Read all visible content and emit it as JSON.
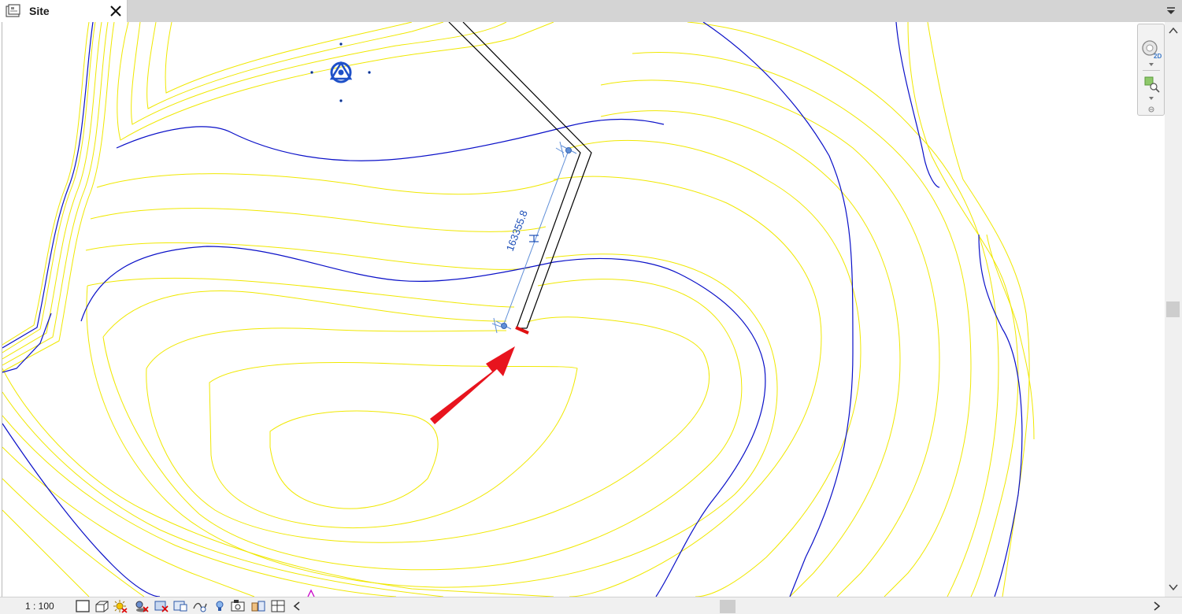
{
  "tab": {
    "title": "Site",
    "icon": "site-view-icon"
  },
  "drawing": {
    "dimension_label": "163355.8",
    "colors": {
      "minor_contour": "#f0e800",
      "major_contour": "#0a10c8",
      "dimension": "#5f8fd8",
      "boundary": "#000000",
      "highlight": "#e01010",
      "annotation_arrow": "#e8141e",
      "survey_point": "#1e50c8"
    }
  },
  "navigation_bar": {
    "icons": [
      "steering-wheel-2d-icon",
      "zoom-region-icon"
    ]
  },
  "status_bar": {
    "scale": "1 : 100",
    "icons": [
      "detail-level-icon",
      "visual-style-icon",
      "sun-path-icon",
      "shadows-icon",
      "crop-view-icon",
      "show-crop-region-icon",
      "unlock-3d-view-icon",
      "temporary-hide-icon",
      "reveal-hidden-icon",
      "temporary-view-properties-icon",
      "hide-analytical-model-icon",
      "highlight-displacement-icon"
    ]
  }
}
